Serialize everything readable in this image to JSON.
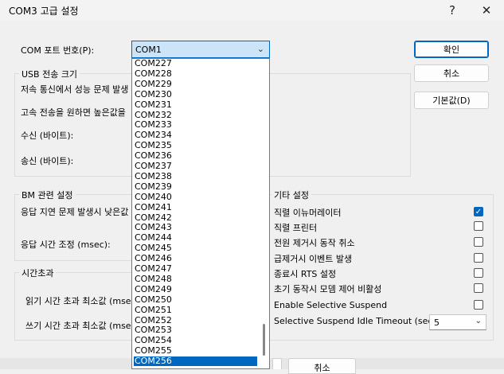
{
  "window": {
    "title": "COM3 고급 설정",
    "help": "?",
    "close": "✕"
  },
  "port": {
    "label": "COM 포트 번호(P):",
    "selected": "COM1",
    "options": [
      "COM227",
      "COM228",
      "COM229",
      "COM230",
      "COM231",
      "COM232",
      "COM233",
      "COM234",
      "COM235",
      "COM236",
      "COM237",
      "COM238",
      "COM239",
      "COM240",
      "COM241",
      "COM242",
      "COM243",
      "COM244",
      "COM245",
      "COM246",
      "COM247",
      "COM248",
      "COM249",
      "COM250",
      "COM251",
      "COM252",
      "COM253",
      "COM254",
      "COM255",
      "COM256"
    ],
    "highlighted": "COM256"
  },
  "buttons": {
    "ok": "확인",
    "cancel": "취소",
    "defaults": "기본값(D)",
    "bottom_cancel": "취소"
  },
  "usb": {
    "title": "USB 전송 크기",
    "line1": "저속 통신에서 성능 문제 발생",
    "line2": "고속 전송을 원하면 높은값을",
    "receive": "수신 (바이트):",
    "send": "송신 (바이트):"
  },
  "bm": {
    "title": "BM 관련 설정",
    "line1": "응답 지연 문제 발생시 낮은값",
    "response_time": "응답 시간 조정 (msec):"
  },
  "timeout": {
    "title": "시간초과",
    "read": "읽기 시간 초과 최소값 (msec",
    "write": "쓰기 시간 초과 최소값 (msec"
  },
  "misc": {
    "title": "기타 설정",
    "items": [
      {
        "label": "직렬 이뉴머레이터",
        "checked": true
      },
      {
        "label": "직렬 프린터",
        "checked": false
      },
      {
        "label": "전원 제거시 동작 취소",
        "checked": false
      },
      {
        "label": "급제거시 이벤트 발생",
        "checked": false
      },
      {
        "label": "종료시 RTS 설정",
        "checked": false
      },
      {
        "label": "초기 동작시 모뎀 제어 비활성",
        "checked": false
      },
      {
        "label": "Enable Selective Suspend",
        "checked": false
      }
    ],
    "idle_timeout_label": "Selective Suspend Idle Timeout (secs):",
    "idle_timeout_value": "5"
  },
  "colors": {
    "accent": "#0067c0",
    "selection_bg": "#cce4f7"
  }
}
